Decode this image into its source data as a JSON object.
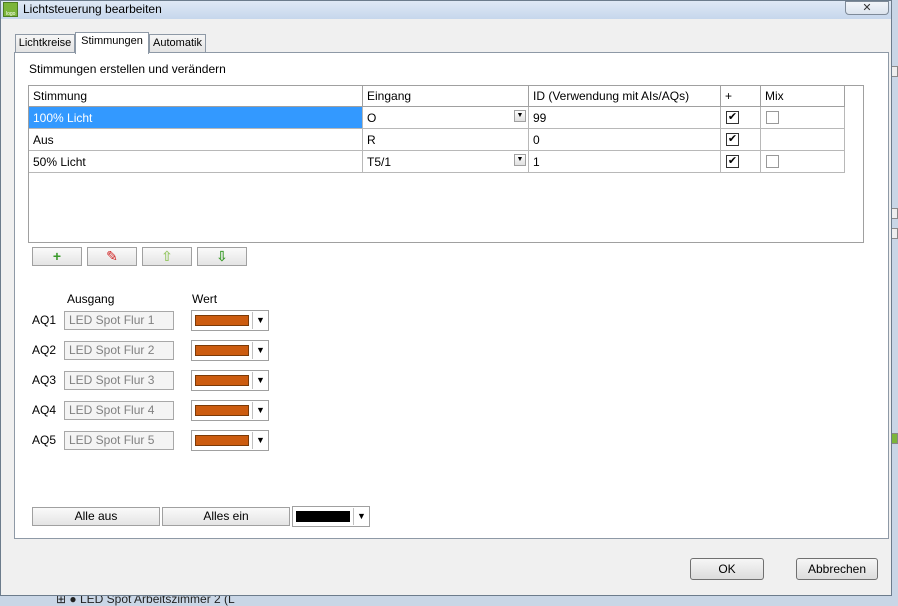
{
  "window": {
    "title": "Lichtsteuerung bearbeiten",
    "close": "✕"
  },
  "tabs": [
    {
      "label": "Lichtkreise",
      "active": false
    },
    {
      "label": "Stimmungen",
      "active": true
    },
    {
      "label": "Automatik",
      "active": false
    }
  ],
  "group_label": "Stimmungen erstellen und verändern",
  "grid": {
    "headers": [
      "Stimmung",
      "Eingang",
      "ID (Verwendung mit AIs/AQs)",
      "+",
      "Mix"
    ],
    "rows": [
      {
        "stimmung": "100% Licht",
        "eingang": "O",
        "id": "99",
        "plus": "✔",
        "mix": ""
      },
      {
        "stimmung": "Aus",
        "eingang": "R",
        "id": "0",
        "plus": "✔",
        "mix": ""
      },
      {
        "stimmung": "50% Licht",
        "eingang": "T5/1",
        "id": "1",
        "plus": "✔",
        "mix": ""
      }
    ]
  },
  "toolbar": {
    "add": "+",
    "erase": "✎",
    "up": "⇧",
    "down": "⇩"
  },
  "outputs": {
    "header_ausgang": "Ausgang",
    "header_wert": "Wert",
    "items": [
      {
        "label": "AQ1",
        "name": "LED Spot Flur 1",
        "color": "#cc5c10"
      },
      {
        "label": "AQ2",
        "name": "LED Spot Flur 2",
        "color": "#cc5c10"
      },
      {
        "label": "AQ3",
        "name": "LED Spot Flur 3",
        "color": "#cc5c10"
      },
      {
        "label": "AQ4",
        "name": "LED Spot Flur 4",
        "color": "#cc5c10"
      },
      {
        "label": "AQ5",
        "name": "LED Spot Flur 5",
        "color": "#cc5c10"
      }
    ]
  },
  "bottom": {
    "alle_aus": "Alle aus",
    "alle_ein": "Alles ein",
    "color": "#000000"
  },
  "dialog": {
    "ok": "OK",
    "cancel": "Abbrechen"
  },
  "background": {
    "tree_item": "LED Spot Arbeitszimmer 2 (L"
  },
  "colors": {
    "selection": "#3399ff",
    "swatch": "#cc5c10"
  }
}
